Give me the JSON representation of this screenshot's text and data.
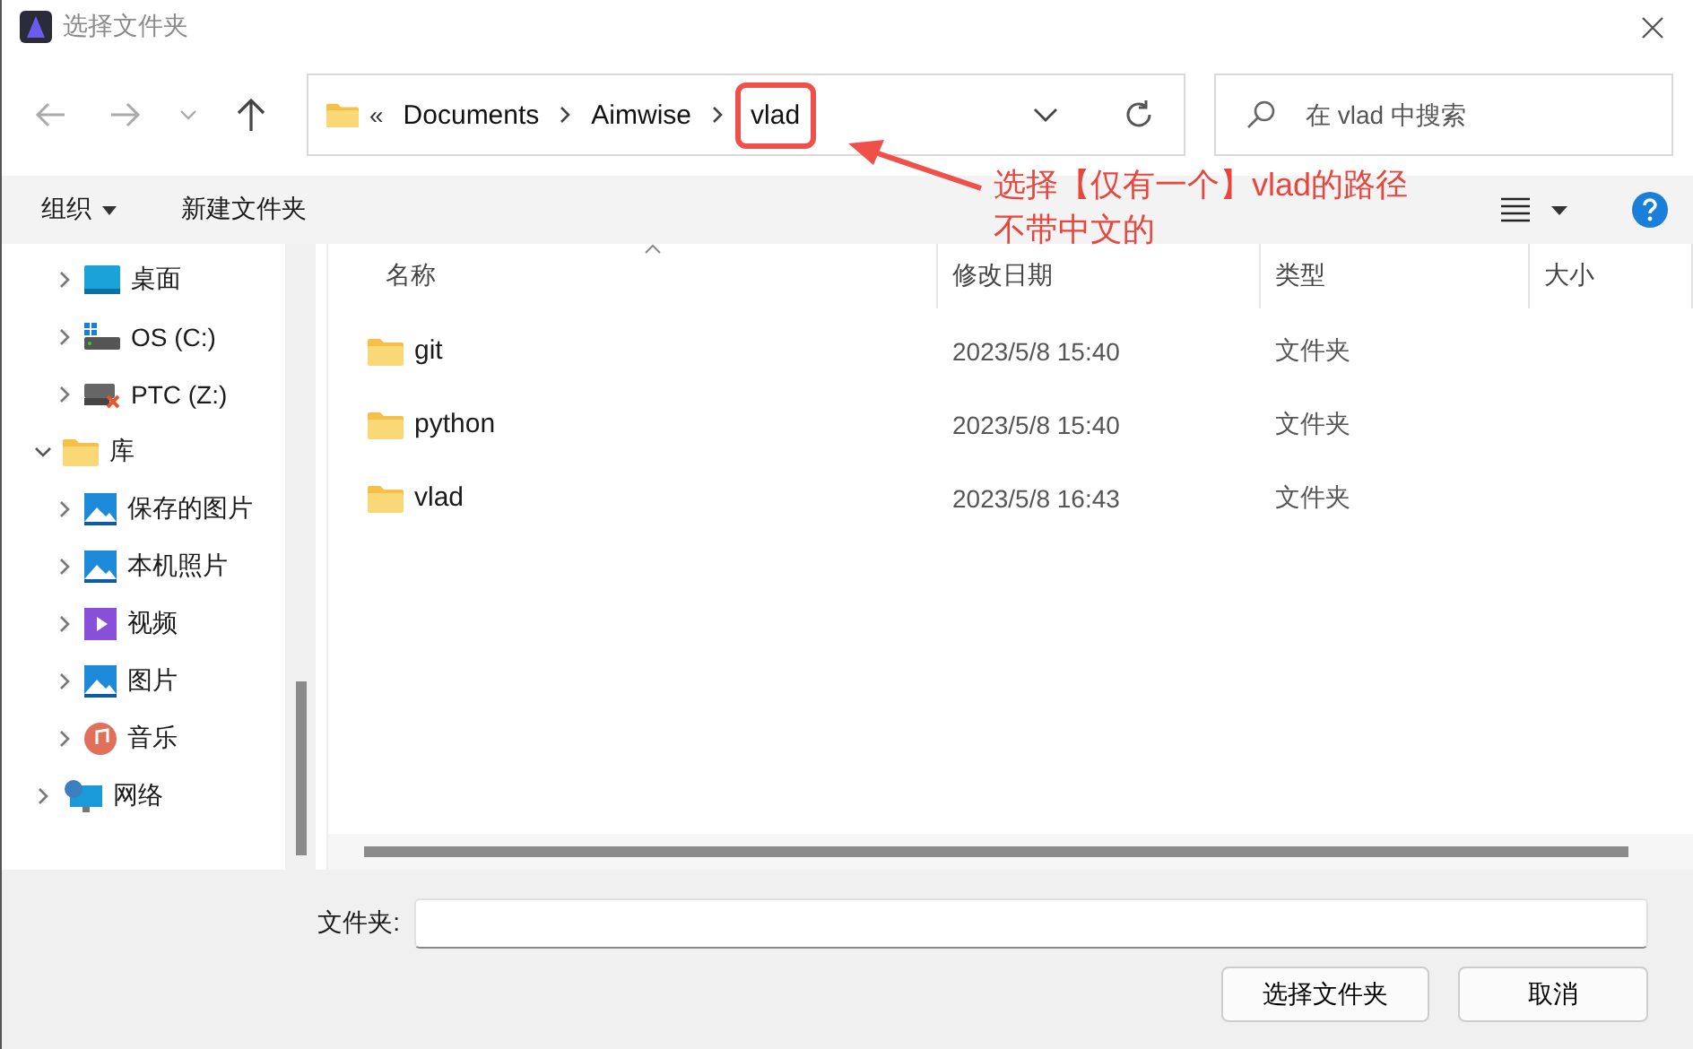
{
  "window": {
    "title": "选择文件夹"
  },
  "address": {
    "overflow": "«",
    "crumbs": [
      {
        "label": "Documents",
        "highlighted": false
      },
      {
        "label": "Aimwise",
        "highlighted": false
      },
      {
        "label": "vlad",
        "highlighted": true
      }
    ]
  },
  "search": {
    "placeholder": "在 vlad 中搜索"
  },
  "annotation": {
    "lines": [
      "选择【仅有一个】vlad的路径",
      "不带中文的"
    ]
  },
  "toolbar": {
    "organize": "组织",
    "new_folder": "新建文件夹"
  },
  "sidebar": {
    "nested_items": [
      {
        "label": "桌面",
        "kind": "desktop",
        "expanded": false
      },
      {
        "label": "OS (C:)",
        "kind": "drive",
        "expanded": false
      },
      {
        "label": "PTC (Z:)",
        "kind": "netdrive",
        "expanded": false
      }
    ],
    "items": [
      {
        "label": "库",
        "kind": "folder",
        "expanded": true,
        "children": [
          {
            "label": "保存的图片",
            "kind": "pictures",
            "expanded": false
          },
          {
            "label": "本机照片",
            "kind": "pictures",
            "expanded": false
          },
          {
            "label": "视频",
            "kind": "video",
            "expanded": false
          },
          {
            "label": "图片",
            "kind": "pictures",
            "expanded": false
          },
          {
            "label": "音乐",
            "kind": "music",
            "expanded": false
          }
        ]
      },
      {
        "label": "网络",
        "kind": "network",
        "expanded": false
      }
    ]
  },
  "table": {
    "columns": [
      "名称",
      "修改日期",
      "类型",
      "大小"
    ],
    "rows": [
      {
        "name": "git",
        "modified": "2023/5/8 15:40",
        "type": "文件夹"
      },
      {
        "name": "python",
        "modified": "2023/5/8 15:40",
        "type": "文件夹"
      },
      {
        "name": "vlad",
        "modified": "2023/5/8 16:43",
        "type": "文件夹"
      }
    ]
  },
  "footer": {
    "folder_label": "文件夹:",
    "buttons": [
      "选择文件夹",
      "取消"
    ]
  }
}
